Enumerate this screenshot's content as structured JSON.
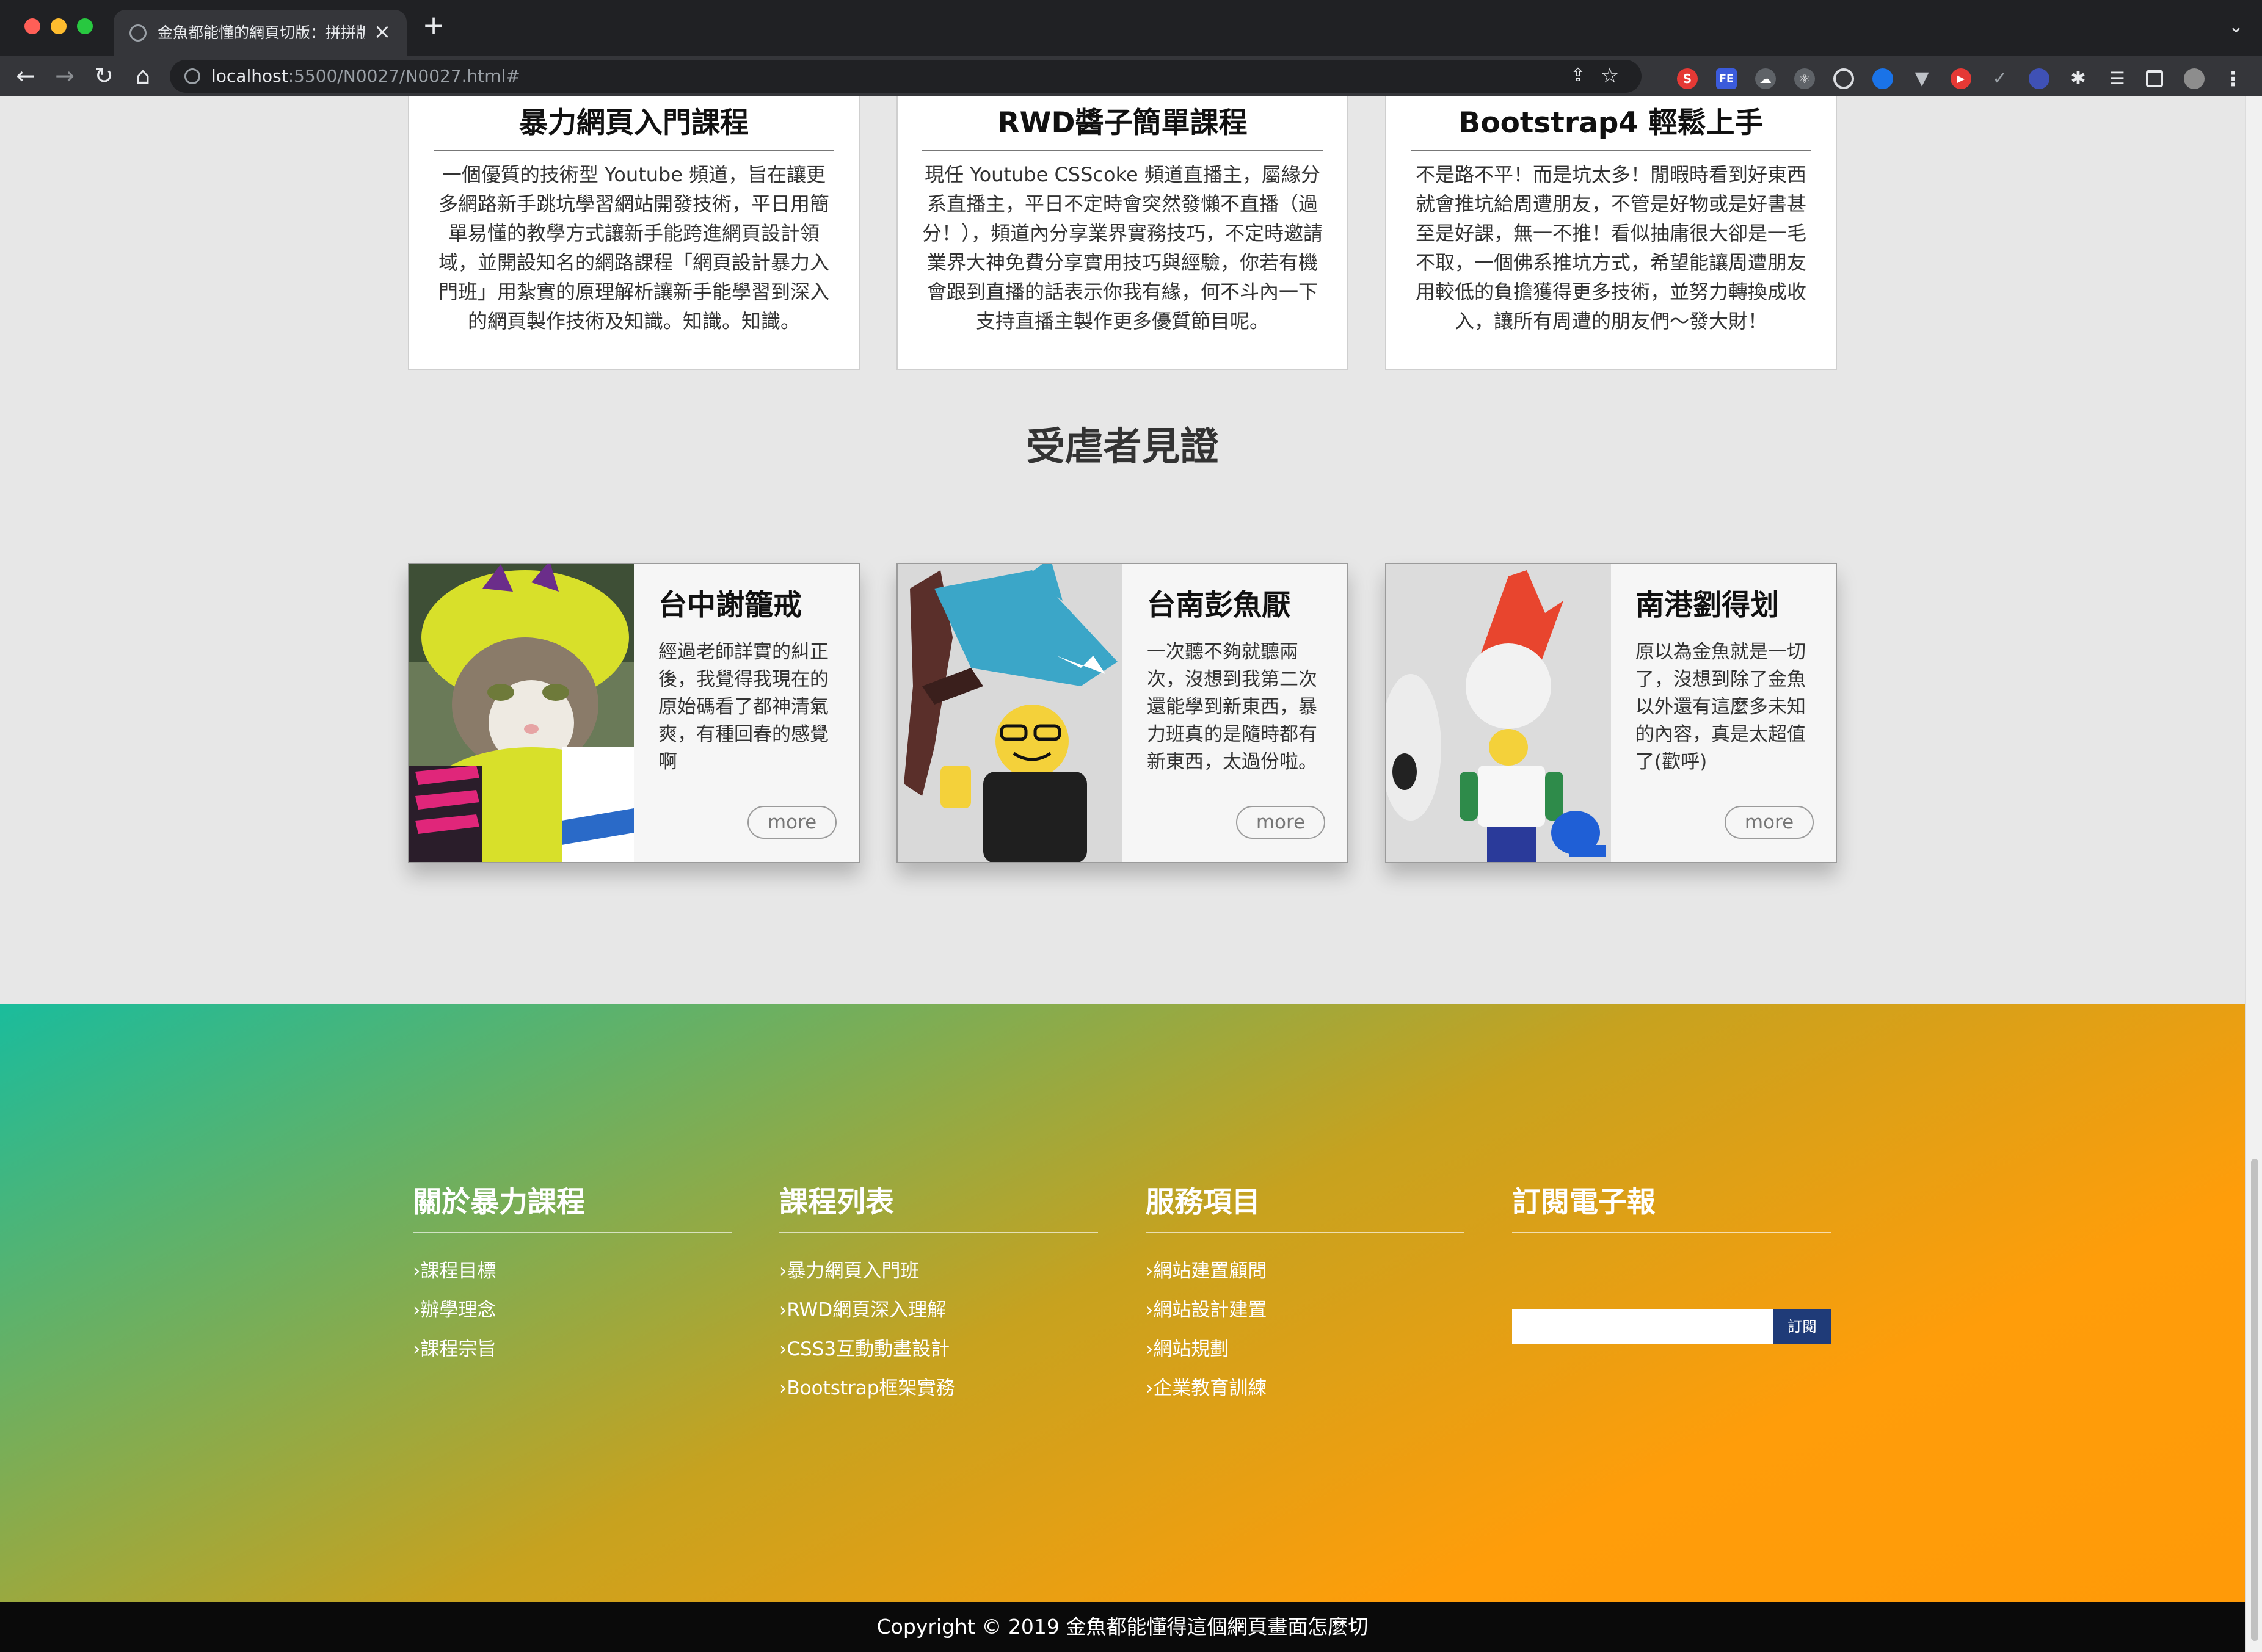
{
  "browser": {
    "tab_title": "金魚都能懂的網頁切版：拼拼版-",
    "tab_close": "×",
    "new_tab": "+",
    "url_host": "localhost",
    "url_rest": ":5500/N0027/N0027.html#",
    "extensions": [
      "S",
      "FE"
    ]
  },
  "courses": [
    {
      "title": "暴力網頁入門課程",
      "text": "一個優質的技術型 Youtube 頻道，旨在讓更多網路新手跳坑學習網站開發技術，平日用簡單易懂的教學方式讓新手能跨進網頁設計領域，並開設知名的網路課程「網頁設計暴力入門班」用紮實的原理解析讓新手能學習到深入的網頁製作技術及知識。知識。知識。"
    },
    {
      "title": "RWD醬子簡單課程",
      "text": "現任 Youtube CSScoke 頻道直播主，屬緣分系直播主，平日不定時會突然發懶不直播（過分！），頻道內分享業界實務技巧，不定時邀請業界大神免費分享實用技巧與經驗，你若有機會跟到直播的話表示你我有緣，何不斗內一下支持直播主製作更多優質節目呢。"
    },
    {
      "title": "Bootstrap4 輕鬆上手",
      "text": "不是路不平！而是坑太多！閒暇時看到好東西就會推坑給周遭朋友，不管是好物或是好書甚至是好課，無一不推！看似抽庸很大卻是一毛不取，一個佛系推坑方式，希望能讓周遭朋友用較低的負擔獲得更多技術，並努力轉換成收入，讓所有周遭的朋友們～發大財！"
    }
  ],
  "testimonials_title": "受虐者見證",
  "testimonials": [
    {
      "name": "台中謝籠戒",
      "text": "經過老師詳實的糾正後，我覺得我現在的原始碼看了都神清氣爽，有種回春的感覺啊",
      "more": "more"
    },
    {
      "name": "台南彭魚厭",
      "text": "一次聽不夠就聽兩次，沒想到我第二次還能學到新東西，暴力班真的是隨時都有新東西，太過份啦。",
      "more": "more"
    },
    {
      "name": "南港劉得划",
      "text": "原以為金魚就是一切了，沒想到除了金魚以外還有這麼多未知的內容，真是太超值了(歡呼)",
      "more": "more"
    }
  ],
  "footer": {
    "columns": [
      {
        "title": "關於暴力課程",
        "items": [
          "›課程目標",
          "›辦學理念",
          "›課程宗旨"
        ]
      },
      {
        "title": "課程列表",
        "items": [
          "›暴力網頁入門班",
          "›RWD網頁深入理解",
          "›CSS3互動動畫設計",
          "›Bootstrap框架實務"
        ]
      },
      {
        "title": "服務項目",
        "items": [
          "›網站建置顧問",
          "›網站設計建置",
          "›網站規劃",
          "›企業教育訓練"
        ]
      }
    ],
    "subscribe": {
      "title": "訂閱電子報",
      "button": "訂閱",
      "input_value": ""
    },
    "copyright": "Copyright © 2019 金魚都能懂得這個網頁畫面怎麼切"
  },
  "colors": {
    "gradient_start": "#1abc9c",
    "gradient_end": "#ff9a08",
    "subscribe_button": "#1f3b78"
  }
}
